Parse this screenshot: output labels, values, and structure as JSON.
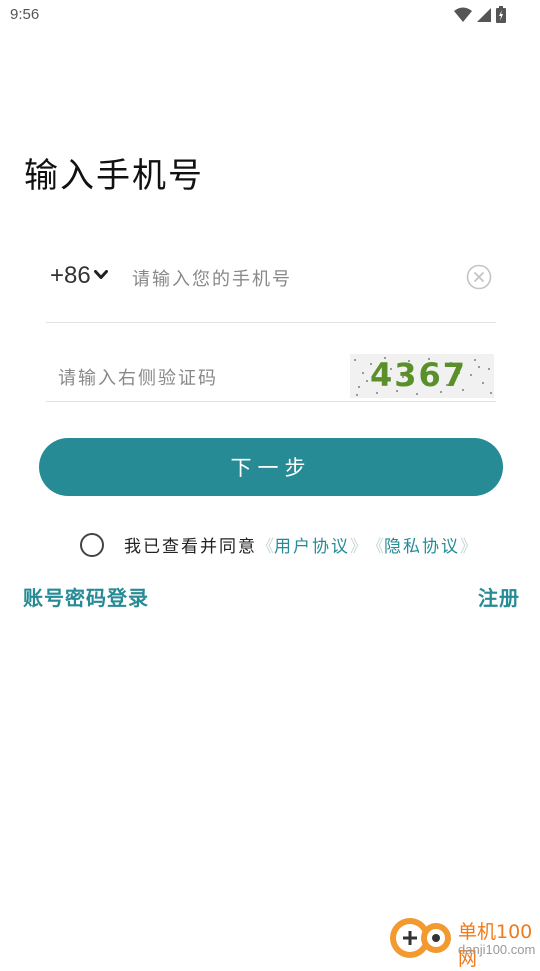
{
  "status_bar": {
    "time": "9:56"
  },
  "title": "输入手机号",
  "phone": {
    "country_code": "+86",
    "placeholder": "请输入您的手机号",
    "value": ""
  },
  "captcha": {
    "placeholder": "请输入右侧验证码",
    "value": "",
    "image_text": "4367"
  },
  "next_button": "下一步",
  "agreement": {
    "prefix": "我已查看并同意",
    "user_agreement": "用户协议",
    "privacy_policy": "隐私协议",
    "bracket_open": "《",
    "bracket_close": "》"
  },
  "bottom_links": {
    "account_login": "账号密码登录",
    "register": "注册"
  },
  "watermark": {
    "name": "单机100网",
    "url": "danji100.com"
  },
  "colors": {
    "accent": "#268b95",
    "captcha_text": "#5a8f2a",
    "watermark": "#ef7b1d"
  }
}
